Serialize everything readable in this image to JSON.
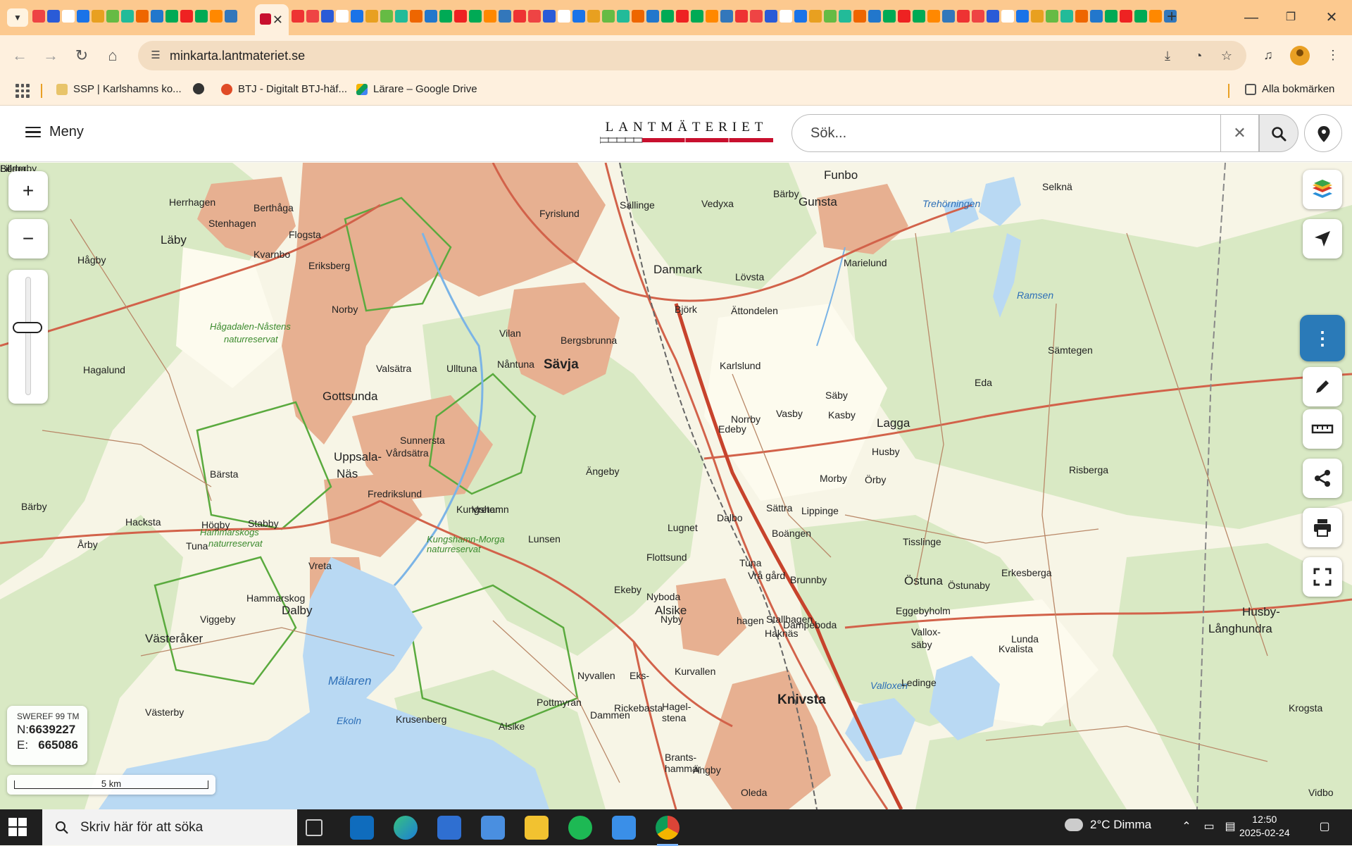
{
  "browser": {
    "url": "minkarta.lantmateriet.se",
    "close_tab_glyph": "✕",
    "new_tab_glyph": "+",
    "bookmarks": [
      {
        "label": "SSP | Karlshamns ko...",
        "color": "#e8c46a"
      },
      {
        "label": "",
        "color": "#333333"
      },
      {
        "label": "BTJ - Digitalt BTJ-häf...",
        "color": "#e04b26"
      },
      {
        "label": "Lärare – Google Drive",
        "color": "#2f9e47"
      }
    ],
    "all_bookmarks_label": "Alla bokmärken"
  },
  "site": {
    "menu_label": "Meny",
    "logo_text": "LANTMÄTERIET",
    "search_placeholder": "Sök...",
    "clear_glyph": "✕",
    "brand_red": "#c8102e"
  },
  "map": {
    "zoom_in": "+",
    "zoom_out": "−",
    "zoom_level": 0.6,
    "coordinate_system": "SWEREF 99 TM",
    "north_label": "N:",
    "north_value": "6639227",
    "east_label": "E:",
    "east_value": "665086",
    "scale_label": "5 km",
    "labels": [
      {
        "text": "Funbo",
        "cls": "big"
      },
      {
        "text": "Gunsta",
        "cls": "big"
      },
      {
        "text": "Danmark",
        "cls": "big"
      },
      {
        "text": "Läby",
        "cls": "big"
      },
      {
        "text": "Gottsunda",
        "cls": "big"
      },
      {
        "text": "Sävja",
        "cls": "bigger"
      },
      {
        "text": "Uppsala-",
        "cls": "big"
      },
      {
        "text": "Näs",
        "cls": "big"
      },
      {
        "text": "Lagga",
        "cls": "big"
      },
      {
        "text": "Östuna",
        "cls": "big"
      },
      {
        "text": "Alsike",
        "cls": "big"
      },
      {
        "text": "Knivsta",
        "cls": "bigger"
      },
      {
        "text": "Dalby",
        "cls": "big"
      },
      {
        "text": "Västeråker",
        "cls": "big"
      },
      {
        "text": "Husby-",
        "cls": "big"
      },
      {
        "text": "Långhundra",
        "cls": "big"
      },
      {
        "text": "Mälaren",
        "cls": "water big"
      },
      {
        "text": "Ekoln",
        "cls": "water"
      },
      {
        "text": "Valloxen",
        "cls": "water"
      },
      {
        "text": "Trehörningen",
        "cls": "water"
      },
      {
        "text": "Ramsen",
        "cls": "water"
      },
      {
        "text": "Hågadalen-Nåstens",
        "cls": "reserve"
      },
      {
        "text": "naturreservat",
        "cls": "reserve"
      },
      {
        "text": "Hammarskogs",
        "cls": "reserve"
      },
      {
        "text": "naturreservat",
        "cls": "reserve"
      },
      {
        "text": "Kungshamn-Morga",
        "cls": "reserve"
      },
      {
        "text": "naturreservat",
        "cls": "reserve"
      },
      {
        "text": "Herrhagen",
        "cls": ""
      },
      {
        "text": "Berthåga",
        "cls": ""
      },
      {
        "text": "Stenhagen",
        "cls": ""
      },
      {
        "text": "Flogsta",
        "cls": ""
      },
      {
        "text": "Kvarnbo",
        "cls": ""
      },
      {
        "text": "Eriksberg",
        "cls": ""
      },
      {
        "text": "Norby",
        "cls": ""
      },
      {
        "text": "Valsätra",
        "cls": ""
      },
      {
        "text": "Ulltuna",
        "cls": ""
      },
      {
        "text": "Vilan",
        "cls": ""
      },
      {
        "text": "Nåntuna",
        "cls": ""
      },
      {
        "text": "Bergsbrunna",
        "cls": ""
      },
      {
        "text": "Sunnersta",
        "cls": ""
      },
      {
        "text": "Vårdsätra",
        "cls": ""
      },
      {
        "text": "Kungshamn",
        "cls": ""
      },
      {
        "text": "Lunsen",
        "cls": ""
      },
      {
        "text": "Fyrislund",
        "cls": ""
      },
      {
        "text": "Sällinge",
        "cls": ""
      },
      {
        "text": "Vedyxa",
        "cls": ""
      },
      {
        "text": "Bärby",
        "cls": ""
      },
      {
        "text": "Lövsta",
        "cls": ""
      },
      {
        "text": "Marielund",
        "cls": ""
      },
      {
        "text": "Selknä",
        "cls": ""
      },
      {
        "text": "Sämtegen",
        "cls": ""
      },
      {
        "text": "Eda",
        "cls": ""
      },
      {
        "text": "Säby",
        "cls": ""
      },
      {
        "text": "Kasby",
        "cls": ""
      },
      {
        "text": "Husby",
        "cls": ""
      },
      {
        "text": "Morby",
        "cls": ""
      },
      {
        "text": "Örby",
        "cls": ""
      },
      {
        "text": "Tisslinge",
        "cls": ""
      },
      {
        "text": "Erkesberga",
        "cls": ""
      },
      {
        "text": "Östunaby",
        "cls": ""
      },
      {
        "text": "Eggebyholm",
        "cls": ""
      },
      {
        "text": "Vallox-",
        "cls": ""
      },
      {
        "text": "säby",
        "cls": ""
      },
      {
        "text": "Kvalista",
        "cls": ""
      },
      {
        "text": "Lunda",
        "cls": ""
      },
      {
        "text": "Ledinge",
        "cls": ""
      },
      {
        "text": "Krogsta",
        "cls": ""
      },
      {
        "text": "Vidbo",
        "cls": ""
      },
      {
        "text": "Risberga",
        "cls": ""
      },
      {
        "text": "Fredrikslund",
        "cls": ""
      },
      {
        "text": "Krusenberg",
        "cls": ""
      },
      {
        "text": "Alsike",
        "cls": ""
      },
      {
        "text": "Rickebasta",
        "cls": ""
      },
      {
        "text": "Hagel-",
        "cls": ""
      },
      {
        "text": "stena",
        "cls": ""
      },
      {
        "text": "Brants-",
        "cls": ""
      },
      {
        "text": "hammar",
        "cls": ""
      },
      {
        "text": "Ängby",
        "cls": ""
      },
      {
        "text": "Oleda",
        "cls": ""
      },
      {
        "text": "Vreta",
        "cls": ""
      },
      {
        "text": "Hammarskog",
        "cls": ""
      },
      {
        "text": "Viggeby",
        "cls": ""
      },
      {
        "text": "Stabby",
        "cls": ""
      },
      {
        "text": "Högby",
        "cls": ""
      },
      {
        "text": "Bärsta",
        "cls": ""
      },
      {
        "text": "Hacksta",
        "cls": ""
      },
      {
        "text": "Tuna",
        "cls": ""
      },
      {
        "text": "Årby",
        "cls": ""
      },
      {
        "text": "Bärby",
        "cls": ""
      },
      {
        "text": "Hågby",
        "cls": ""
      },
      {
        "text": "Hagalund",
        "cls": ""
      },
      {
        "text": "Västerby",
        "cls": ""
      },
      {
        "text": "Björk",
        "cls": ""
      },
      {
        "text": "Ängeby",
        "cls": ""
      },
      {
        "text": "Vreten",
        "cls": ""
      },
      {
        "text": "Lugnet",
        "cls": ""
      },
      {
        "text": "Flottsund",
        "cls": ""
      },
      {
        "text": "Nyby",
        "cls": ""
      },
      {
        "text": "Nyboda",
        "cls": ""
      },
      {
        "text": "Kurvallen",
        "cls": ""
      },
      {
        "text": "Ekeby",
        "cls": ""
      },
      {
        "text": "Nyvallen",
        "cls": ""
      },
      {
        "text": "Pottmyran",
        "cls": ""
      },
      {
        "text": "Dammen",
        "cls": ""
      },
      {
        "text": "Eks-",
        "cls": ""
      },
      {
        "text": "hagen",
        "cls": ""
      },
      {
        "text": "Tuna",
        "cls": ""
      },
      {
        "text": "Haknäs",
        "cls": ""
      },
      {
        "text": "Stallhagen",
        "cls": ""
      },
      {
        "text": "Dampeboda",
        "cls": ""
      },
      {
        "text": "Vrå gård",
        "cls": ""
      },
      {
        "text": "Boängen",
        "cls": ""
      },
      {
        "text": "Lippinge",
        "cls": ""
      },
      {
        "text": "Brunnby",
        "cls": ""
      },
      {
        "text": "Sättra",
        "cls": ""
      },
      {
        "text": "Dalbo",
        "cls": ""
      },
      {
        "text": "Ättondelen",
        "cls": ""
      },
      {
        "text": "Karlslund",
        "cls": ""
      },
      {
        "text": "Vasby",
        "cls": ""
      },
      {
        "text": "Norrby",
        "cls": ""
      },
      {
        "text": "Edeby",
        "cls": ""
      },
      {
        "text": "Berga",
        "cls": ""
      },
      {
        "text": "Lilla",
        "cls": ""
      },
      {
        "text": "Söderby",
        "cls": ""
      }
    ]
  },
  "taskbar": {
    "search_placeholder": "Skriv här för att söka",
    "weather": "2°C  Dimma",
    "time": "12:50",
    "date": "2025-02-24"
  }
}
